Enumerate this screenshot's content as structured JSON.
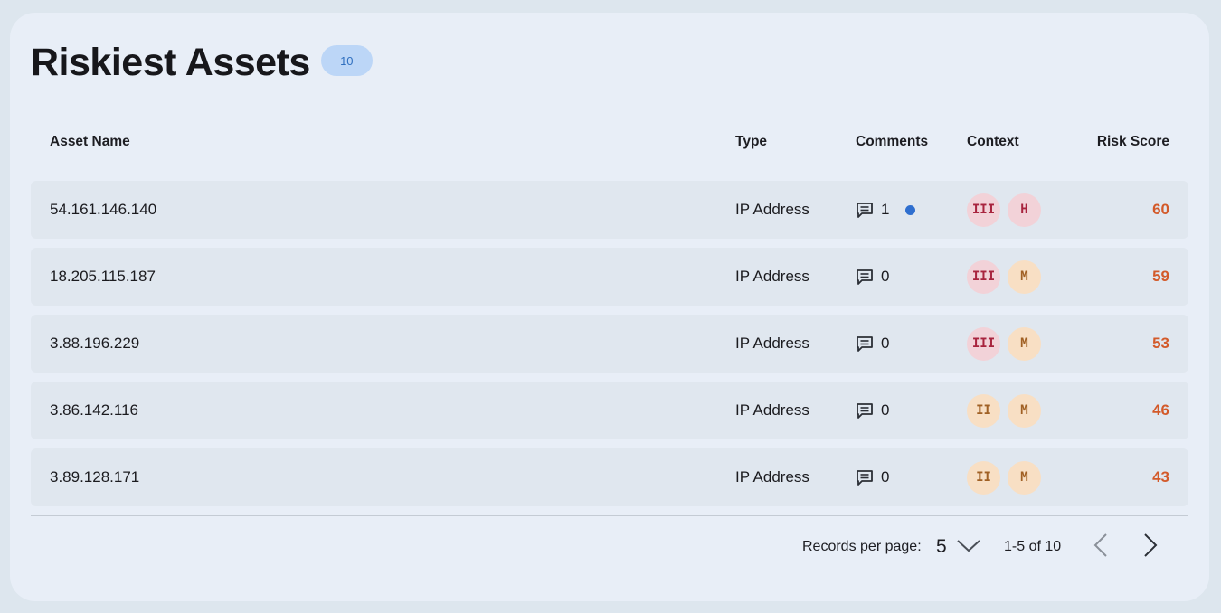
{
  "header": {
    "title": "Riskiest Assets",
    "count": "10"
  },
  "table": {
    "columns": {
      "name": "Asset Name",
      "type": "Type",
      "comments": "Comments",
      "context": "Context",
      "risk": "Risk Score"
    },
    "rows": [
      {
        "name": "54.161.146.140",
        "type": "IP Address",
        "comments": "1",
        "unread": true,
        "context": [
          {
            "label": "III",
            "tone": "red"
          },
          {
            "label": "H",
            "tone": "red"
          }
        ],
        "risk": "60"
      },
      {
        "name": "18.205.115.187",
        "type": "IP Address",
        "comments": "0",
        "unread": false,
        "context": [
          {
            "label": "III",
            "tone": "red"
          },
          {
            "label": "M",
            "tone": "orange"
          }
        ],
        "risk": "59"
      },
      {
        "name": "3.88.196.229",
        "type": "IP Address",
        "comments": "0",
        "unread": false,
        "context": [
          {
            "label": "III",
            "tone": "red"
          },
          {
            "label": "M",
            "tone": "orange"
          }
        ],
        "risk": "53"
      },
      {
        "name": "3.86.142.116",
        "type": "IP Address",
        "comments": "0",
        "unread": false,
        "context": [
          {
            "label": "II",
            "tone": "orange"
          },
          {
            "label": "M",
            "tone": "orange"
          }
        ],
        "risk": "46"
      },
      {
        "name": "3.89.128.171",
        "type": "IP Address",
        "comments": "0",
        "unread": false,
        "context": [
          {
            "label": "II",
            "tone": "orange"
          },
          {
            "label": "M",
            "tone": "orange"
          }
        ],
        "risk": "43"
      }
    ]
  },
  "footer": {
    "records_label": "Records per page:",
    "records_value": "5",
    "range": "1-5 of 10",
    "prev_icon": "chevron-left-icon",
    "next_icon": "chevron-right-icon"
  },
  "colors": {
    "risk": "#d35a2a",
    "badge_bg": "#bcd6f7",
    "unread_dot": "#2f6fcf"
  }
}
